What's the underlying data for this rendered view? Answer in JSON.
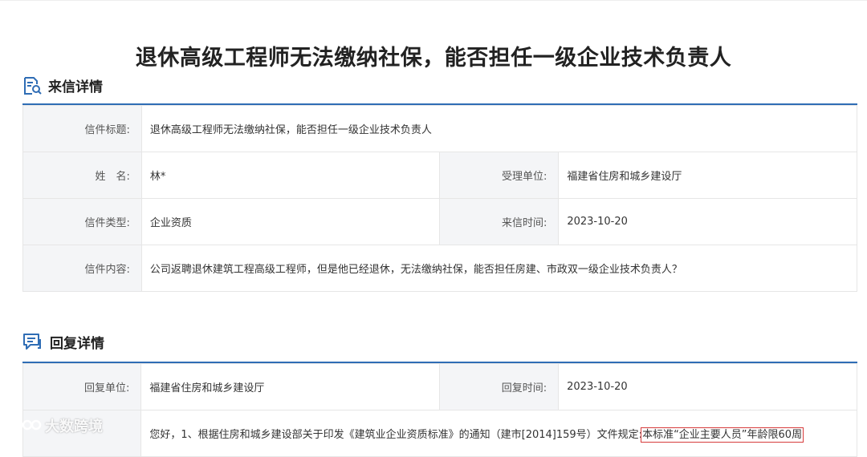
{
  "page": {
    "title": "退休高级工程师无法缴纳社保，能否担任一级企业技术负责人"
  },
  "letter_section": {
    "heading": "来信详情",
    "subject_label": "信件标题:",
    "subject_value": "退休高级工程师无法缴纳社保，能否担任一级企业技术负责人",
    "name_label": "姓　名:",
    "name_value": "林*",
    "unit_label": "受理单位:",
    "unit_value": "福建省住房和城乡建设厅",
    "type_label": "信件类型:",
    "type_value": "企业资质",
    "date_label": "来信时间:",
    "date_value": "2023-10-20",
    "content_label": "信件内容:",
    "content_value": "公司返聘退休建筑工程高级工程师，但是他已经退休，无法缴纳社保，能否担任房建、市政双一级企业技术负责人？"
  },
  "reply_section": {
    "heading": "回复详情",
    "unit_label": "回复单位:",
    "unit_value": "福建省住房和城乡建设厅",
    "date_label": "回复时间:",
    "date_value": "2023-10-20",
    "content_value_prefix": "您好，1、根据住房和城乡建设部关于印发《建筑业企业资质标准》的通知（建市[2014]159号）文件规定:",
    "content_value_highlight": "本标准“企业主要人员”年龄限60周"
  },
  "watermark": {
    "text": "大数跨境"
  },
  "icons": [
    "document-search-icon",
    "chat-reply-icon",
    "watermark-logo-icon"
  ],
  "colors": {
    "accent": "#2f6db5",
    "label_bg": "#f4f5f7",
    "highlight_border": "#d73c3c"
  }
}
